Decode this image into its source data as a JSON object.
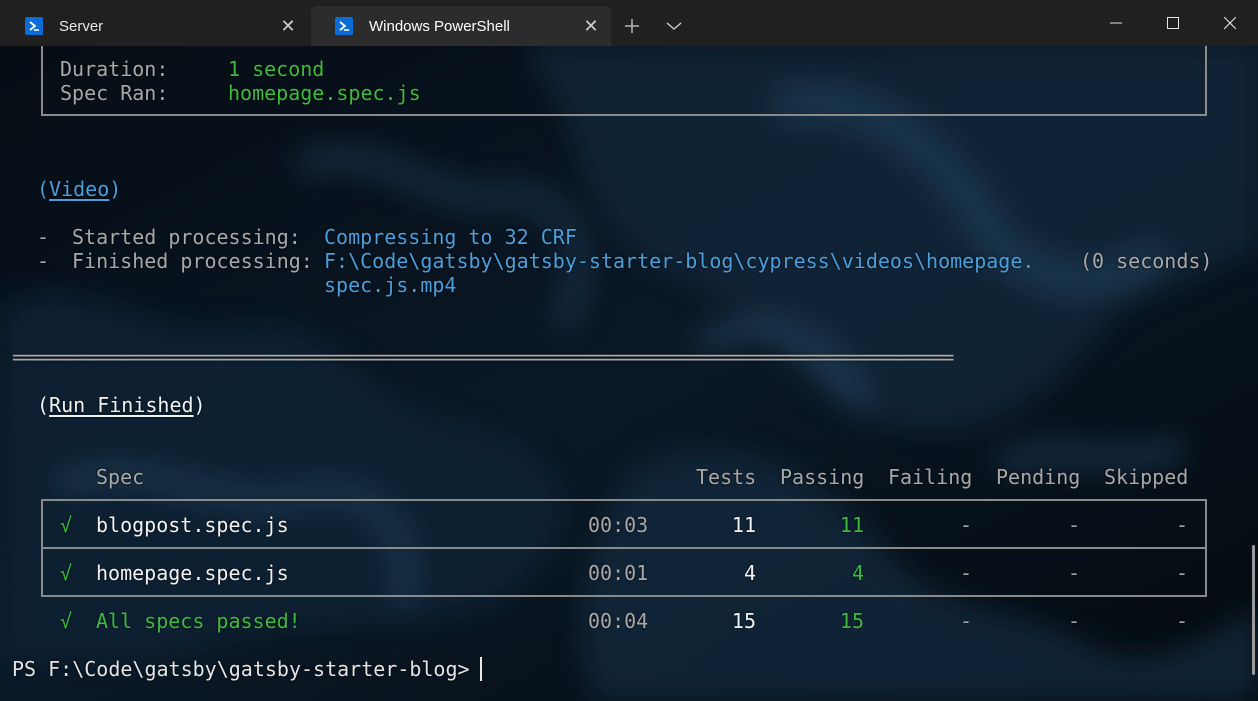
{
  "tabs": [
    {
      "label": "Server",
      "active": false
    },
    {
      "label": "Windows PowerShell",
      "active": true
    }
  ],
  "icons": {
    "tab_icon": "powershell-icon",
    "close": "close-icon",
    "new_tab": "plus-icon",
    "dropdown": "chevron-down-icon",
    "minimize": "minimize-icon",
    "maximize": "maximize-icon",
    "window_close": "close-icon"
  },
  "colors": {
    "accent_green": "#3fb93f",
    "link_blue": "#4a9fdc",
    "muted": "#a8a8a8"
  },
  "summary": {
    "duration_label": "Duration:",
    "duration_value": "1 second",
    "spec_ran_label": "Spec Ran:",
    "spec_ran_value": "homepage.spec.js"
  },
  "video": {
    "heading": "Video",
    "started_label": "Started processing:",
    "started_value": "Compressing to 32 CRF",
    "finished_label": "Finished processing:",
    "finished_value_1": "F:\\Code\\gatsby\\gatsby-starter-blog\\cypress\\videos\\homepage.",
    "finished_value_2": "spec.js.mp4",
    "finished_time": "(0 seconds)"
  },
  "separator": "==================================================================================================",
  "run_finished": "Run Finished",
  "table": {
    "headers": {
      "spec": "Spec",
      "tests": "Tests",
      "passing": "Passing",
      "failing": "Failing",
      "pending": "Pending",
      "skipped": "Skipped"
    },
    "rows": [
      {
        "check": "√",
        "spec": "blogpost.spec.js",
        "time": "00:03",
        "tests": "11",
        "passing": "11",
        "failing": "-",
        "pending": "-",
        "skipped": "-"
      },
      {
        "check": "√",
        "spec": "homepage.spec.js",
        "time": "00:01",
        "tests": "4",
        "passing": "4",
        "failing": "-",
        "pending": "-",
        "skipped": "-"
      }
    ],
    "total": {
      "check": "√",
      "spec": "All specs passed!",
      "time": "00:04",
      "tests": "15",
      "passing": "15",
      "failing": "-",
      "pending": "-",
      "skipped": "-"
    }
  },
  "prompt": "PS F:\\Code\\gatsby\\gatsby-starter-blog>"
}
